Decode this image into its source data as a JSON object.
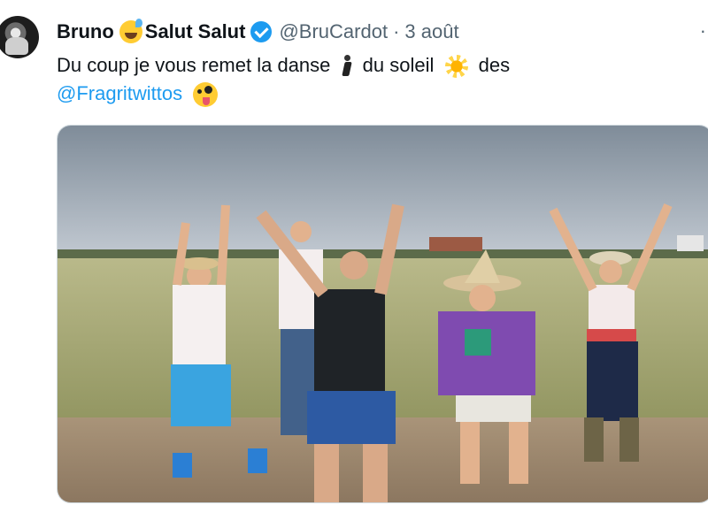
{
  "tweet": {
    "author_name": "Bruno",
    "display_suffix": "Salut Salut",
    "handle": "@BruCardot",
    "separator": "·",
    "date": "3 août",
    "more_label": "·",
    "text_part1": "Du coup je vous remet la danse",
    "text_part2": "du soleil",
    "text_part3": "des",
    "mention": "@Fragritwittos"
  },
  "icons": {
    "avatar": "avatar-photo",
    "emoji1": "sweat-smile-emoji",
    "verified": "verified-badge-icon",
    "emoji2": "man-dancing-emoji",
    "emoji3": "sun-emoji",
    "emoji4": "zany-face-emoji",
    "more": "more-options-icon"
  },
  "colors": {
    "link": "#1d9bf0",
    "secondary_text": "#536471",
    "primary_text": "#0f1419"
  },
  "media": {
    "type": "photo",
    "description_visible": false
  }
}
